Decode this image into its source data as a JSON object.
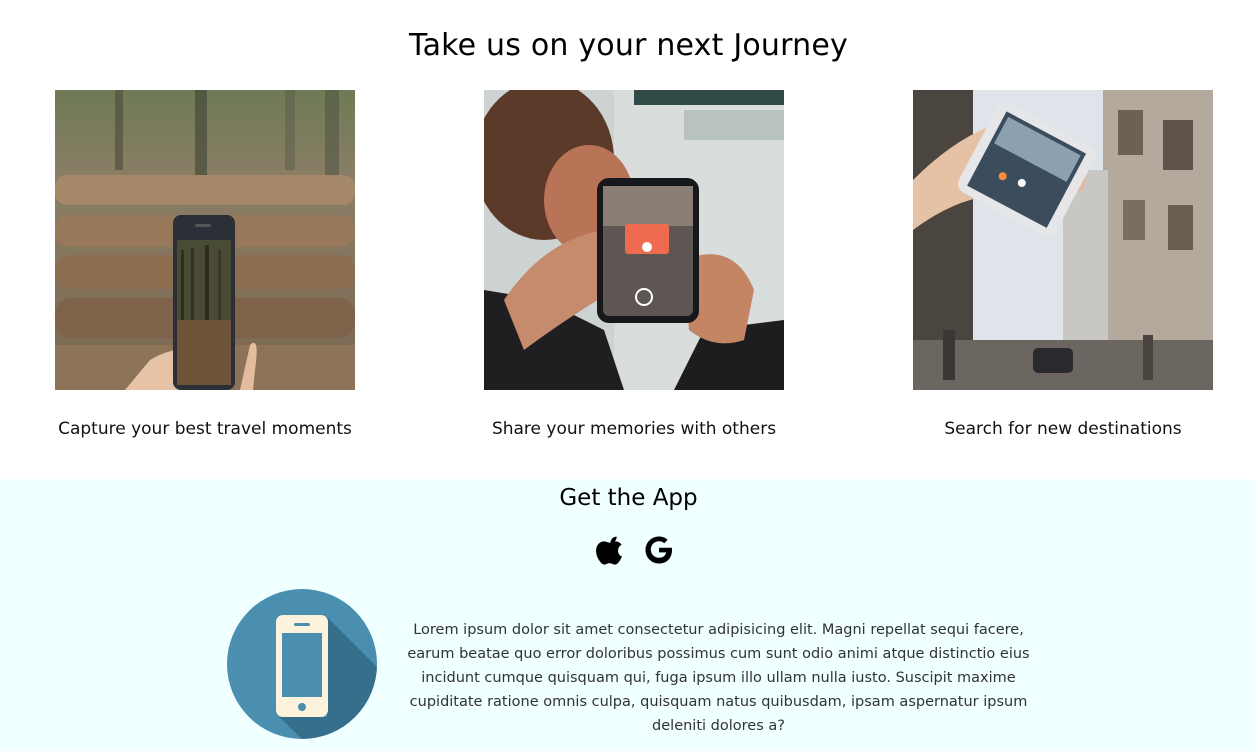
{
  "journey": {
    "title": "Take us on your next Journey",
    "cards": [
      {
        "caption": "Capture your best travel moments",
        "image": "phone-photographing-forest-logs"
      },
      {
        "caption": "Share your memories with others",
        "image": "person-taking-photo-with-phone"
      },
      {
        "caption": "Search for new destinations",
        "image": "hand-holding-phone-city-street"
      }
    ]
  },
  "app": {
    "title": "Get the App",
    "icons": [
      "apple-icon",
      "google-icon"
    ],
    "illustration": "smartphone-icon",
    "description": "Lorem ipsum dolor sit amet consectetur adipisicing elit. Magni repellat sequi facere, earum beatae quo error doloribus possimus cum sunt odio animi atque distinctio eius incidunt cumque quisquam qui, fuga ipsum illo ullam nulla iusto. Suscipit maxime cupiditate ratione omnis culpa, quisquam natus quibusdam, ipsam aspernatur ipsum deleniti dolores a?"
  },
  "colors": {
    "app_background": "#f0ffff",
    "badge_circle": "#4a90b0",
    "badge_shadow": "#3a7390",
    "phone_body": "#fdf3dc"
  }
}
